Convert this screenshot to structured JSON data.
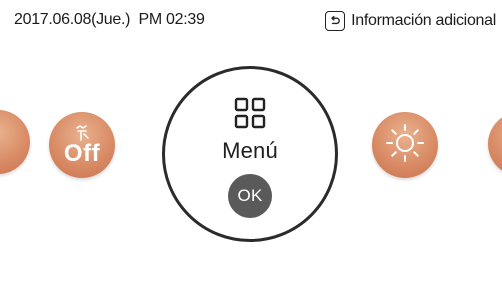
{
  "status_bar": {
    "datetime": "2017.06.08(Jue.)  PM 02:39",
    "info_label": "Información adicional",
    "info_icon": "back-arrow-icon"
  },
  "carousel": {
    "off_item": {
      "icon": "fan-icon",
      "label": "Off"
    },
    "center": {
      "icon": "grid-icon",
      "label": "Menú",
      "ok_label": "OK"
    },
    "sun_item": {
      "icon": "sun-icon"
    }
  },
  "colors": {
    "orb_accent": "#d98c66",
    "ok_button": "#5a5a5a",
    "dial_border": "#2b2b2b"
  }
}
